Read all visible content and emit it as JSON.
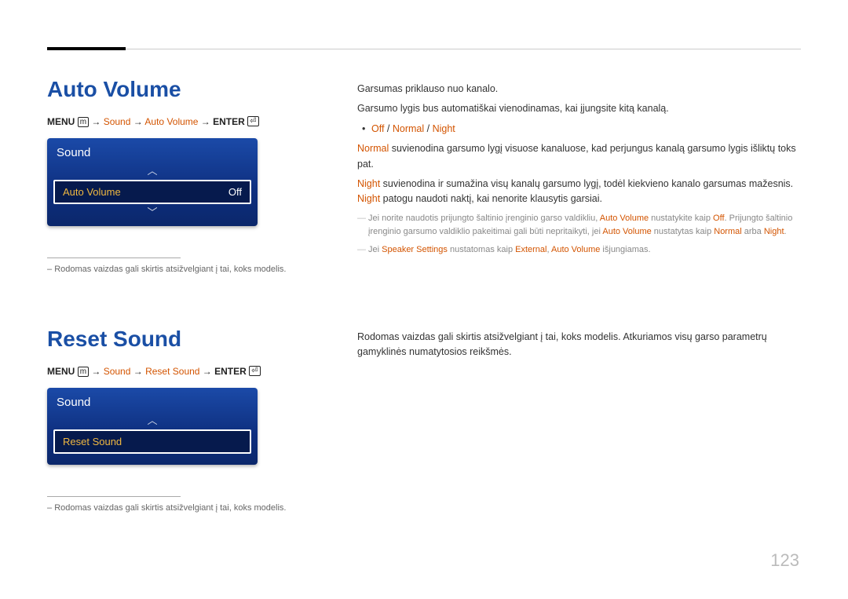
{
  "page_number": "123",
  "section1": {
    "heading": "Auto Volume",
    "path_parts": [
      "MENU",
      "Sound",
      "Auto Volume",
      "ENTER"
    ],
    "path_menu_icon": "m",
    "menu": {
      "title": "Sound",
      "row_label": "Auto Volume",
      "row_value": "Off"
    },
    "footnote": "Rodomas vaizdas gali skirtis atsižvelgiant į tai, koks modelis.",
    "body": {
      "p1": "Garsumas priklauso nuo kanalo.",
      "p2": "Garsumo lygis bus automatiškai vienodinamas, kai įjungsite kitą kanalą.",
      "opt_off": "Off",
      "opt_normal": "Normal",
      "opt_night": "Night",
      "sep": " / ",
      "p3_pre": "Normal",
      "p3_rest": " suvienodina garsumo lygį visuose kanaluose, kad perjungus kanalą garsumo lygis išliktų toks pat.",
      "p4_pre": "Night",
      "p4_mid": " suvienodina ir sumažina visų kanalų garsumo lygį, todėl kiekvieno kanalo garsumas mažesnis. ",
      "p4_post": "Night",
      "p4_end": " patogu naudoti naktį, kai nenorite klausytis garsiai.",
      "note1_a": "Jei norite naudotis prijungto šaltinio įrenginio garso valdikliu, ",
      "note1_b": "Auto Volume",
      "note1_c": " nustatykite kaip ",
      "note1_d": "Off",
      "note1_e": ". Prijungto šaltinio įrenginio garsumo valdiklio pakeitimai gali būti nepritaikyti, jei ",
      "note1_f": "Auto Volume",
      "note1_g": " nustatytas kaip ",
      "note1_h": "Normal",
      "note1_i": " arba ",
      "note1_j": "Night",
      "note1_k": ".",
      "note2_a": "Jei ",
      "note2_b": "Speaker Settings",
      "note2_c": " nustatomas kaip ",
      "note2_d": "External",
      "note2_e": ", ",
      "note2_f": "Auto Volume",
      "note2_g": " išjungiamas."
    }
  },
  "section2": {
    "heading": "Reset Sound",
    "path_parts": [
      "MENU",
      "Sound",
      "Reset Sound",
      "ENTER"
    ],
    "path_menu_icon": "m",
    "menu": {
      "title": "Sound",
      "row_label": "Reset Sound"
    },
    "footnote": "Rodomas vaizdas gali skirtis atsižvelgiant į tai, koks modelis.",
    "body": {
      "p1": "Rodomas vaizdas gali skirtis atsižvelgiant į tai, koks modelis. Atkuriamos visų garso parametrų gamyklinės numatytosios reikšmės."
    }
  }
}
